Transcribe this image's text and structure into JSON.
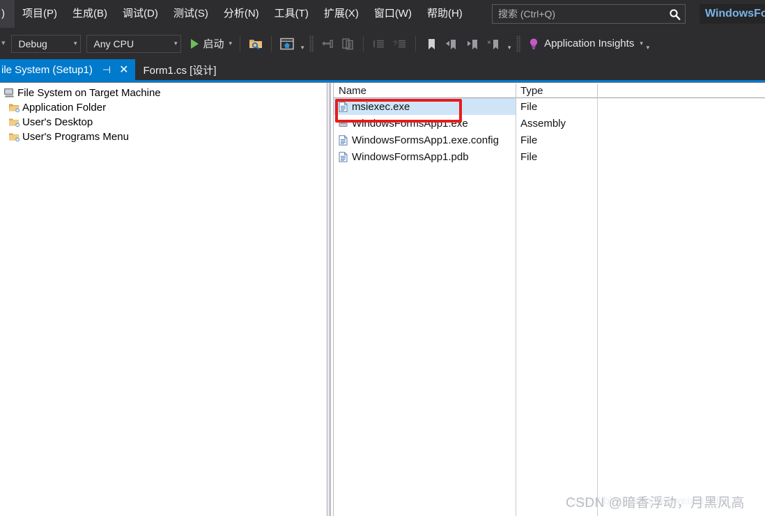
{
  "menubar": {
    "items": [
      {
        "label": ")",
        "name": "menu-item-clipped"
      },
      {
        "label": "项目(P)",
        "name": "menu-item-project"
      },
      {
        "label": "生成(B)",
        "name": "menu-item-build"
      },
      {
        "label": "调试(D)",
        "name": "menu-item-debug"
      },
      {
        "label": "测试(S)",
        "name": "menu-item-test"
      },
      {
        "label": "分析(N)",
        "name": "menu-item-analyze"
      },
      {
        "label": "工具(T)",
        "name": "menu-item-tools"
      },
      {
        "label": "扩展(X)",
        "name": "menu-item-extensions"
      },
      {
        "label": "窗口(W)",
        "name": "menu-item-window"
      },
      {
        "label": "帮助(H)",
        "name": "menu-item-help"
      }
    ],
    "search": {
      "placeholder": "搜索 (Ctrl+Q)",
      "value": ""
    },
    "project_badge": "WindowsFo"
  },
  "toolbar": {
    "configuration": "Debug",
    "platform": "Any CPU",
    "run_label": "启动",
    "app_insights_label": "Application Insights"
  },
  "tabs": [
    {
      "label": "ile System (Setup1)",
      "active": true
    },
    {
      "label": "Form1.cs [设计]",
      "active": false
    }
  ],
  "tree": {
    "root": {
      "label": "File System on Target Machine",
      "icon": "computer-icon"
    },
    "children": [
      {
        "label": "Application Folder",
        "icon": "folder-open-icon"
      },
      {
        "label": "User's Desktop",
        "icon": "folder-icon"
      },
      {
        "label": "User's Programs Menu",
        "icon": "folder-icon"
      }
    ]
  },
  "filelist": {
    "columns": [
      "Name",
      "Type"
    ],
    "rows": [
      {
        "name": "msiexec.exe",
        "type": "File",
        "selected": true,
        "highlighted": true
      },
      {
        "name": "WindowsFormsApp1.exe",
        "type": "Assembly",
        "selected": false,
        "highlighted": false
      },
      {
        "name": "WindowsFormsApp1.exe.config",
        "type": "File",
        "selected": false,
        "highlighted": false
      },
      {
        "name": "WindowsFormsApp1.pdb",
        "type": "File",
        "selected": false,
        "highlighted": false
      }
    ]
  },
  "annotation": {
    "color": "#e81b1b",
    "target": "msiexec.exe"
  },
  "watermark": {
    "text": "CSDN @暗香浮动，月黑风高",
    "url": "https://blog.csdn.net/weixin_465"
  },
  "theme": {
    "chrome_bg": "#2d2d30",
    "accent": "#007acc",
    "selection": "#cfe5f7"
  }
}
